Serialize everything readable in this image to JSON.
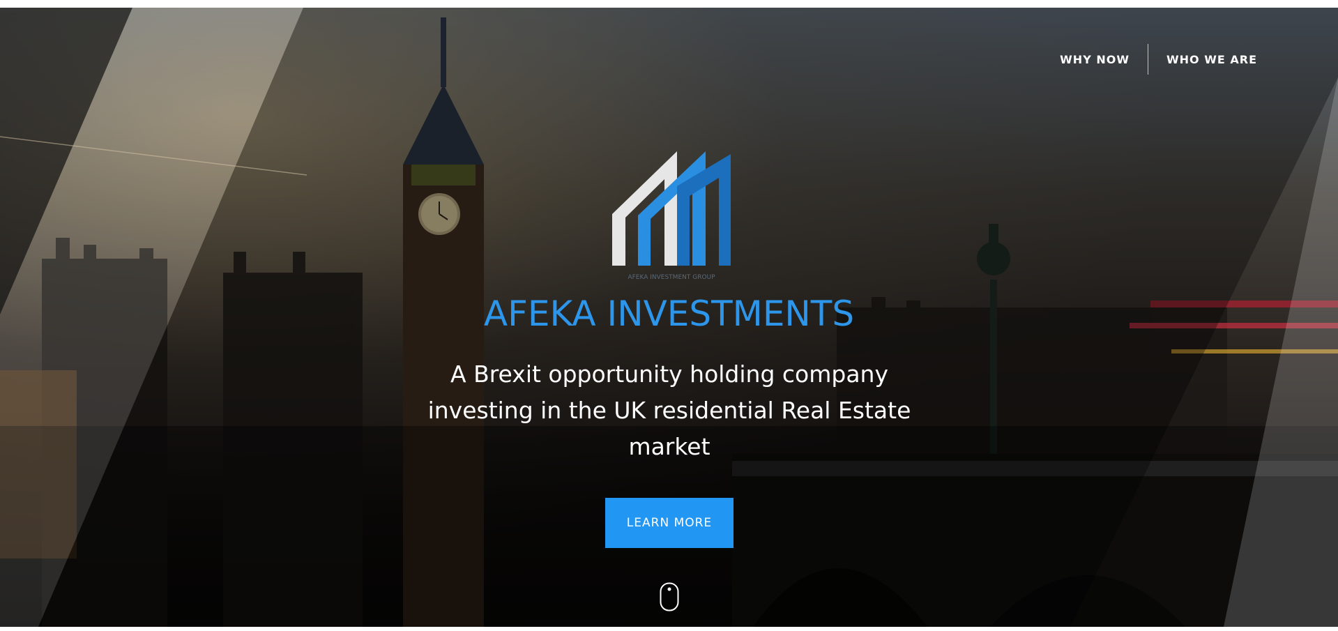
{
  "nav": {
    "items": [
      {
        "label": "WHY NOW"
      },
      {
        "label": "WHO WE ARE"
      }
    ]
  },
  "logo": {
    "subtext": "AFEKA INVESTMENT GROUP"
  },
  "hero": {
    "title": "AFEKA INVESTMENTS",
    "tagline": "A Brexit opportunity holding company investing in the UK residential Real Estate market",
    "cta_label": "LEARN MORE",
    "scroll_icon": "mouse-scroll-icon"
  },
  "colors": {
    "accent": "#2196f3",
    "title": "#2d96ea",
    "text": "#ffffff"
  }
}
